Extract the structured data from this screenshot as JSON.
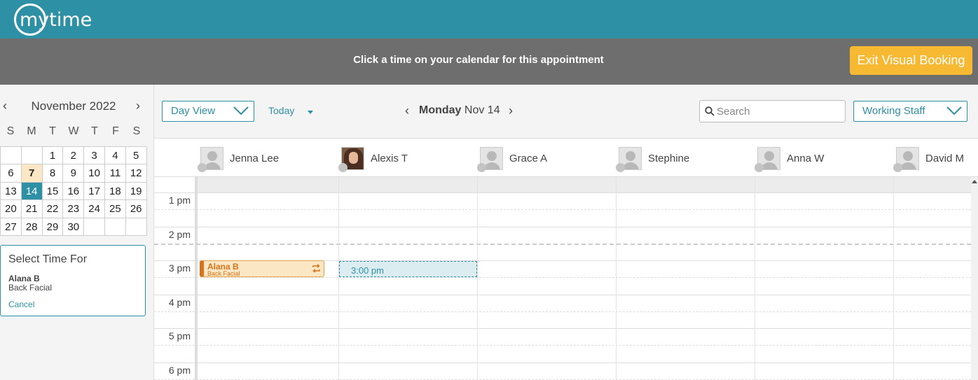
{
  "brand": {
    "logo_text": "mytime"
  },
  "banner": {
    "message": "Click a time on your calendar for this appointment",
    "exit_label": "Exit Visual Booking"
  },
  "mini_calendar": {
    "title": "November 2022",
    "dow": [
      "S",
      "M",
      "T",
      "W",
      "T",
      "F",
      "S"
    ],
    "days": [
      "",
      "",
      "1",
      "2",
      "3",
      "4",
      "5",
      "6",
      "7",
      "8",
      "9",
      "10",
      "11",
      "12",
      "13",
      "14",
      "15",
      "16",
      "17",
      "18",
      "19",
      "20",
      "21",
      "22",
      "23",
      "24",
      "25",
      "26",
      "27",
      "28",
      "29",
      "30",
      "",
      "",
      ""
    ],
    "today": "7",
    "selected": "14"
  },
  "select_time": {
    "title": "Select Time For",
    "client": "Alana B",
    "service": "Back Facial",
    "cancel": "Cancel"
  },
  "toolbar": {
    "view_select": "Day View",
    "today_label": "Today",
    "date_weekday": "Monday",
    "date_rest": "Nov 14",
    "search_placeholder": "Search",
    "staff_filter": "Working Staff"
  },
  "staff": [
    {
      "name": "Jenna Lee",
      "photo": false
    },
    {
      "name": "Alexis T",
      "photo": true
    },
    {
      "name": "Grace A",
      "photo": false
    },
    {
      "name": "Stephine",
      "photo": false
    },
    {
      "name": "Anna W",
      "photo": false
    },
    {
      "name": "David M",
      "photo": false
    }
  ],
  "time_labels": [
    "1 pm",
    "2 pm",
    "3 pm",
    "4 pm",
    "5 pm",
    "6 pm"
  ],
  "appointment": {
    "client": "Alana B",
    "service": "Back Facial",
    "icon": "repeat-icon"
  },
  "selection": {
    "time": "3:00 pm"
  },
  "colors": {
    "brand": "#2e90a5",
    "banner": "#6e6e6e",
    "exit_button": "#f7b832",
    "appt_accent": "#d9731a",
    "today_highlight": "#fbe7c3"
  }
}
